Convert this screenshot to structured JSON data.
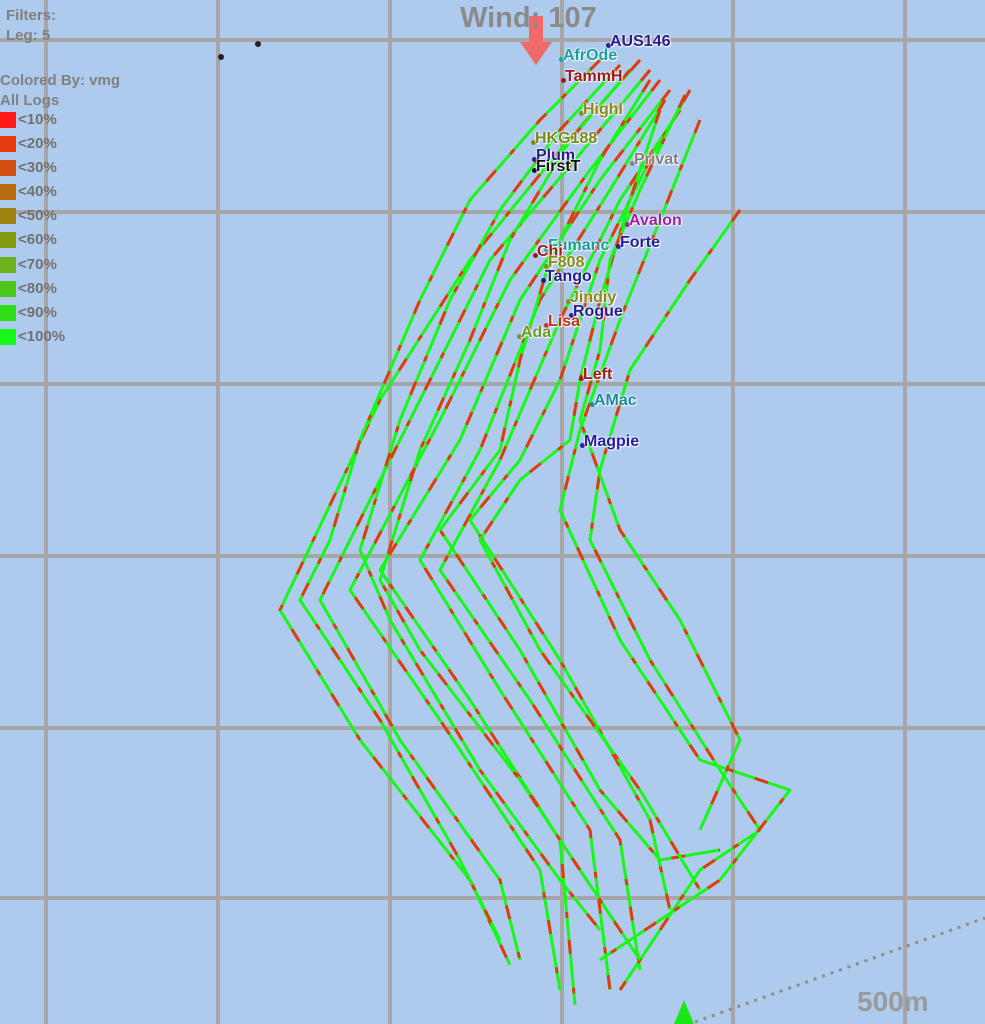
{
  "header": {
    "filters_label": "Filters:",
    "leg_label": "Leg: 5",
    "colored_by_label": "Colored By: vmg",
    "logs_label": "All Logs"
  },
  "wind": {
    "label": "Wind: 107",
    "arrow_color": "#f06a6a"
  },
  "legend": [
    {
      "label": "<10%",
      "color": "#ff1a1a"
    },
    {
      "label": "<20%",
      "color": "#e83a10"
    },
    {
      "label": "<30%",
      "color": "#d04e10"
    },
    {
      "label": "<40%",
      "color": "#b86a10"
    },
    {
      "label": "<50%",
      "color": "#9c8210"
    },
    {
      "label": "<60%",
      "color": "#869a10"
    },
    {
      "label": "<70%",
      "color": "#6cb21a"
    },
    {
      "label": "<80%",
      "color": "#4cc61a"
    },
    {
      "label": "<90%",
      "color": "#30de18"
    },
    {
      "label": "<100%",
      "color": "#18f818"
    }
  ],
  "boats": [
    {
      "name": "AUS146",
      "color": "#2a1a8a"
    },
    {
      "name": "AfrOde",
      "color": "#1aa0a0"
    },
    {
      "name": "TammH",
      "color": "#a01818"
    },
    {
      "name": "Highl",
      "color": "#8a8a18"
    },
    {
      "name": "HKG188",
      "color": "#7a8a18"
    },
    {
      "name": "Plum",
      "color": "#2a1a8a"
    },
    {
      "name": "FirstT",
      "color": "#111111"
    },
    {
      "name": "Privat",
      "color": "#808080"
    },
    {
      "name": "Avalon",
      "color": "#a020a0"
    },
    {
      "name": "Forte",
      "color": "#2a1aa0"
    },
    {
      "name": "Fumanc",
      "color": "#1a9a9a"
    },
    {
      "name": "Chi",
      "color": "#a01818"
    },
    {
      "name": "F808",
      "color": "#8a8a18"
    },
    {
      "name": "Tango",
      "color": "#2a1a8a"
    },
    {
      "name": "Jindiy",
      "color": "#8a8a18"
    },
    {
      "name": "Rogue",
      "color": "#2a1a8a"
    },
    {
      "name": "Lisa",
      "color": "#c03020"
    },
    {
      "name": "Ada",
      "color": "#6a9a28"
    },
    {
      "name": "Left",
      "color": "#a01818"
    },
    {
      "name": "AMac",
      "color": "#1a8a9a"
    },
    {
      "name": "Magpie",
      "color": "#2a1aa0"
    }
  ],
  "scale": {
    "label": "500m"
  },
  "colors": {
    "water": "#aecbee",
    "grid": "#a6a6a6",
    "track_fast": "#18f818",
    "track_slow": "#e03a10",
    "start_marker": "#18e818"
  }
}
